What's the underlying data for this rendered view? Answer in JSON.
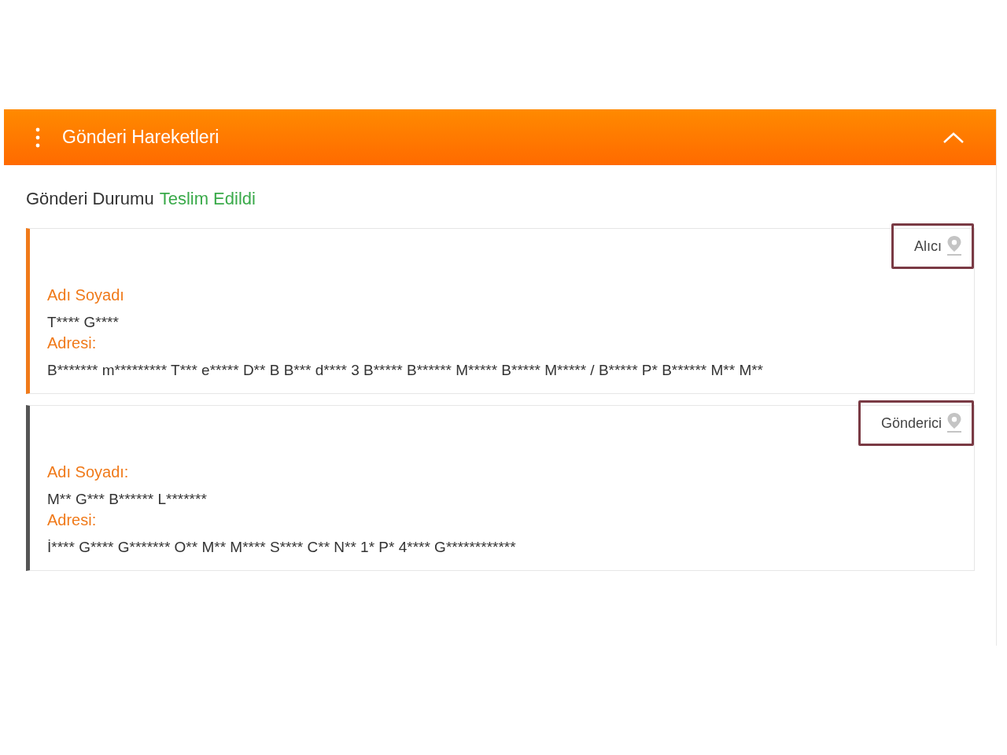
{
  "panel": {
    "title": "Gönderi Hareketleri",
    "expanded": true
  },
  "status": {
    "label": "Gönderi Durumu",
    "value": "Teslim Edildi"
  },
  "parties": [
    {
      "tag": "Alıcı",
      "highlighted": true,
      "color": "#f07a1a",
      "name_label": "Adı Soyadı",
      "name": "T**** G****",
      "address_label": "Adresi:",
      "address": "B******* m********* T*** e***** D** B B*** d**** 3 B***** B****** M***** B***** M***** / B***** P* B****** M** M**"
    },
    {
      "tag": "Gönderici",
      "highlighted": true,
      "color": "#555555",
      "name_label": "Adı Soyadı:",
      "name": "M** G*** B****** L*******",
      "address_label": "Adresi:",
      "address": "İ**** G**** G******* O** M** M**** S**** C** N** 1* P* 4**** G************"
    }
  ]
}
